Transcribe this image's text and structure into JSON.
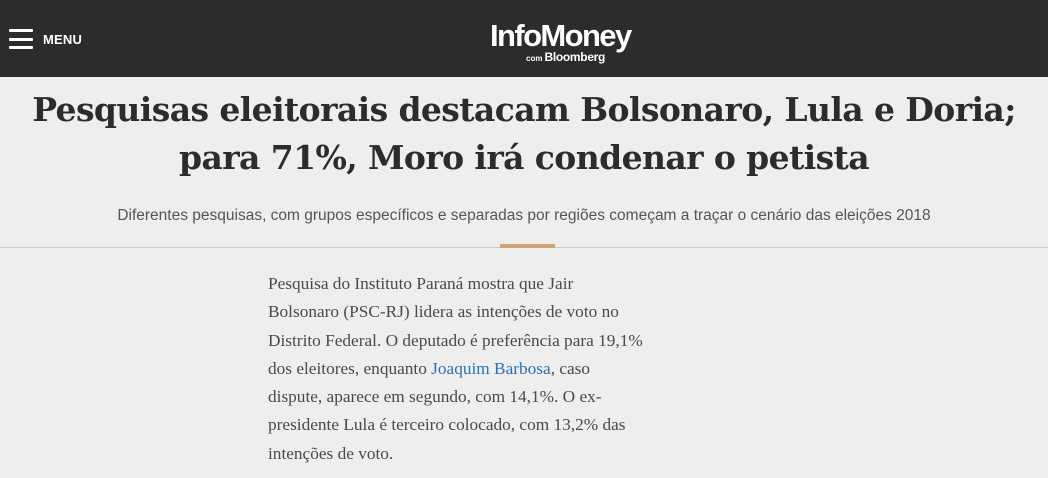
{
  "header": {
    "menu_label": "MENU",
    "logo_main": "InfoMoney",
    "logo_com": "com",
    "logo_partner": "Bloomberg"
  },
  "article": {
    "headline_lines": [
      "Pesquisas eleitorais destacam Bolsonaro, Lula e Doria;",
      "para 71%, Moro irá condenar o petista"
    ],
    "subtitle": "Diferentes pesquisas, com grupos específicos e separadas por regiões começam a traçar o cenário das eleições 2018",
    "body": {
      "line1": "Pesquisa do Instituto Paraná mostra que Jair",
      "line2": "Bolsonaro (PSC-RJ) lidera as intenções de voto no",
      "line3": "Distrito Federal. O deputado é preferência para 19,1%",
      "line4_before": "dos eleitores, enquanto ",
      "line4_link": "Joaquim Barbosa",
      "line4_after": ", caso",
      "line5": "dispute, aparece em segundo, com 14,1%. O ex-",
      "line6": "presidente Lula é terceiro colocado, com 13,2% das",
      "line7": "intenções de voto."
    }
  },
  "colors": {
    "topbar": "#2c2c2c",
    "background": "#eeeeee",
    "accent": "#d2a372",
    "link": "#2a73b5"
  },
  "icons": [
    "hamburger-menu-icon"
  ]
}
